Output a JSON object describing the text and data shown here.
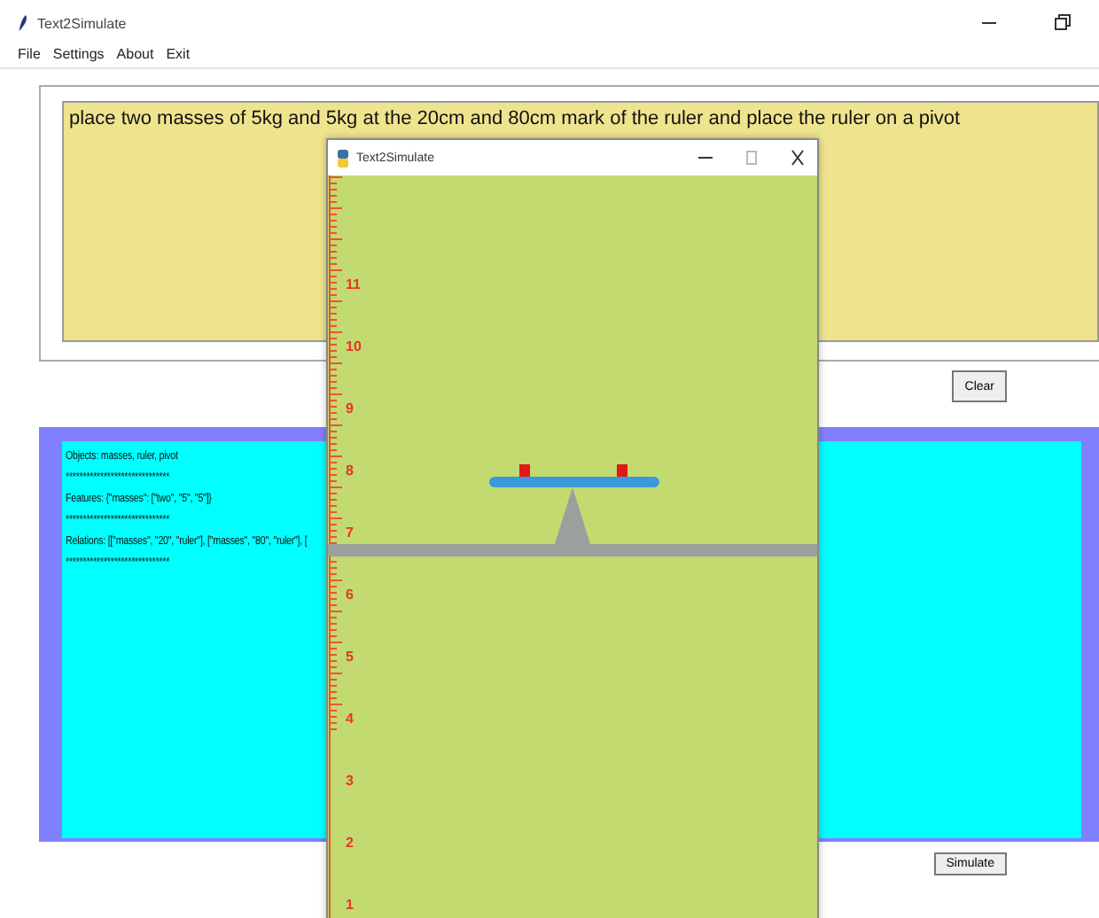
{
  "window": {
    "title": "Text2Simulate"
  },
  "menu": [
    "File",
    "Settings",
    "About",
    "Exit"
  ],
  "prompt": {
    "value": "place two masses of 5kg and 5kg at the 20cm and 80cm mark of the ruler and place the ruler on a pivot"
  },
  "clear_button": "Clear",
  "output": [
    "Objects: masses, ruler, pivot",
    "******************************",
    "Features: {\"masses\": [\"two\", \"5\", \"5\"]}",
    "******************************",
    "Relations: [[\"masses\", \"20\", \"ruler\"], [\"masses\", \"80\", \"ruler\"], [",
    "******************************"
  ],
  "simulate_button": "Simulate",
  "sim_window": {
    "title": "Text2Simulate",
    "ruler_labels": [
      "11",
      "10",
      "9",
      "8",
      "7",
      "6",
      "5",
      "4",
      "3",
      "2",
      "1"
    ]
  }
}
